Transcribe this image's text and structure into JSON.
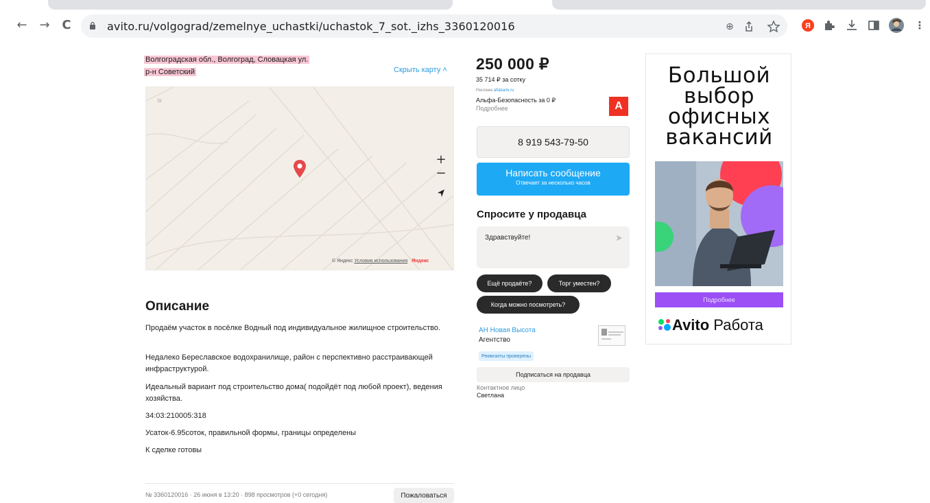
{
  "browser": {
    "url": "avito.ru/volgograd/zemelnye_uchastki/uchastok_7_sot._izhs_3360120016",
    "back_glyph": "←",
    "forward_glyph": "→",
    "reload_glyph": "C",
    "zoom_glyph": "⊕",
    "menu_glyph": "⋮",
    "ext_letter": "Я"
  },
  "listing": {
    "address_line1": "Волгоградская обл., Волгоград, Словацкая ул.",
    "address_line2": "р-н Советский",
    "hide_map": "Скрыть карту ˄",
    "map_corner": "St",
    "map_zoom_in": "+",
    "map_zoom_out": "−",
    "map_locate": "➤",
    "map_copyright": "© Яндекс",
    "map_terms": "Условия использования",
    "map_brand": "Яндекс",
    "description_title": "Описание",
    "description": [
      "Продаём участок в посёлке Водный под индивидуальное жилищное строительство.",
      "Недалеко Береславское водохранилище, район с перспективно расстраивающей инфраструктурой.",
      "Идеальный вариант под строительство дома( подойдёт под любой проект), ведения хозяйства.",
      "34:03:210005:318",
      "Усаток-6.95соток, правильной формы, границы определены",
      "К сделке готовы"
    ],
    "meta": "№ 3360120016 · 26 июня в 13:20 · 898 просмотров (+0 сегодня)",
    "complain": "Пожаловаться"
  },
  "sidebar": {
    "price": "250 000 ₽",
    "price_per": "35 714 ₽ за сотку",
    "ad_label": "Реклама",
    "ad_domain": "alfabank.ru",
    "ad_title": "Альфа-Безопасность за 0 ₽",
    "ad_more": "Подробнее",
    "ad_logo": "А",
    "phone": "8 919 543-79-50",
    "message_btn": "Написать сообщение",
    "message_sub": "Отвечает за несколько часов",
    "ask_title": "Спросите у продавца",
    "ask_placeholder": "Здравствуйте!",
    "ask_send": "➤",
    "chips": [
      "Ещё продаёте?",
      "Торг уместен?",
      "Когда можно посмотреть?"
    ],
    "agency_name": "АН Новая Высота",
    "agency_type": "Агентство",
    "verified": "Реквизиты проверены",
    "subscribe": "Подписаться на продавца",
    "contact_label": "Контактное лицо",
    "contact_name": "Светлана"
  },
  "banner": {
    "headline_lines": [
      "Большой",
      "выбор",
      "офисных",
      "вакансий"
    ],
    "button": "Подробнее",
    "brand_bold": "Avito",
    "brand_rest": " Работа"
  },
  "colors": {
    "accent_blue": "#1ea9f5",
    "map_pin": "#e5484d",
    "address_highlight": "#f7c6d4",
    "banner_button": "#9b4ff5"
  }
}
